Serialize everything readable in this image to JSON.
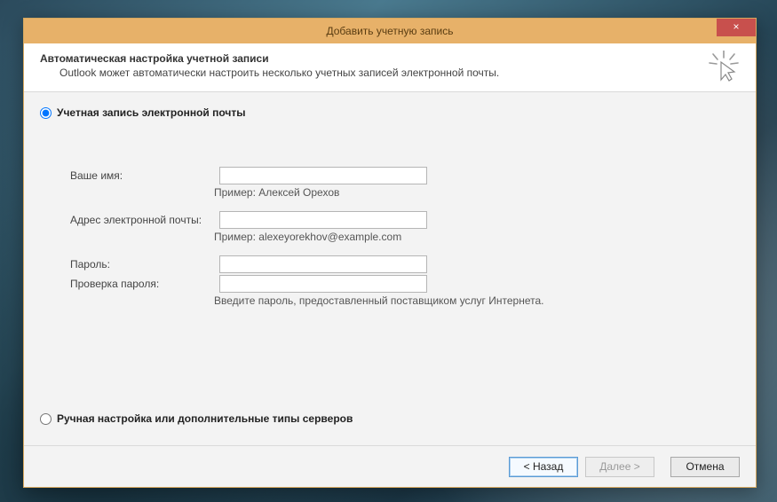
{
  "window": {
    "title": "Добавить учетную запись"
  },
  "header": {
    "title": "Автоматическая настройка учетной записи",
    "subtitle": "Outlook может автоматически настроить несколько учетных записей электронной почты."
  },
  "options": {
    "email_account": "Учетная запись электронной почты",
    "manual": "Ручная настройка или дополнительные типы серверов"
  },
  "form": {
    "name_label": "Ваше имя:",
    "name_value": "",
    "name_hint": "Пример: Алексей Орехов",
    "email_label": "Адрес электронной почты:",
    "email_value": "",
    "email_hint": "Пример: alexeyorekhov@example.com",
    "password_label": "Пароль:",
    "password_value": "",
    "password2_label": "Проверка пароля:",
    "password2_value": "",
    "password_hint": "Введите пароль, предоставленный поставщиком услуг Интернета."
  },
  "footer": {
    "back": "< Назад",
    "next": "Далее >",
    "cancel": "Отмена"
  }
}
